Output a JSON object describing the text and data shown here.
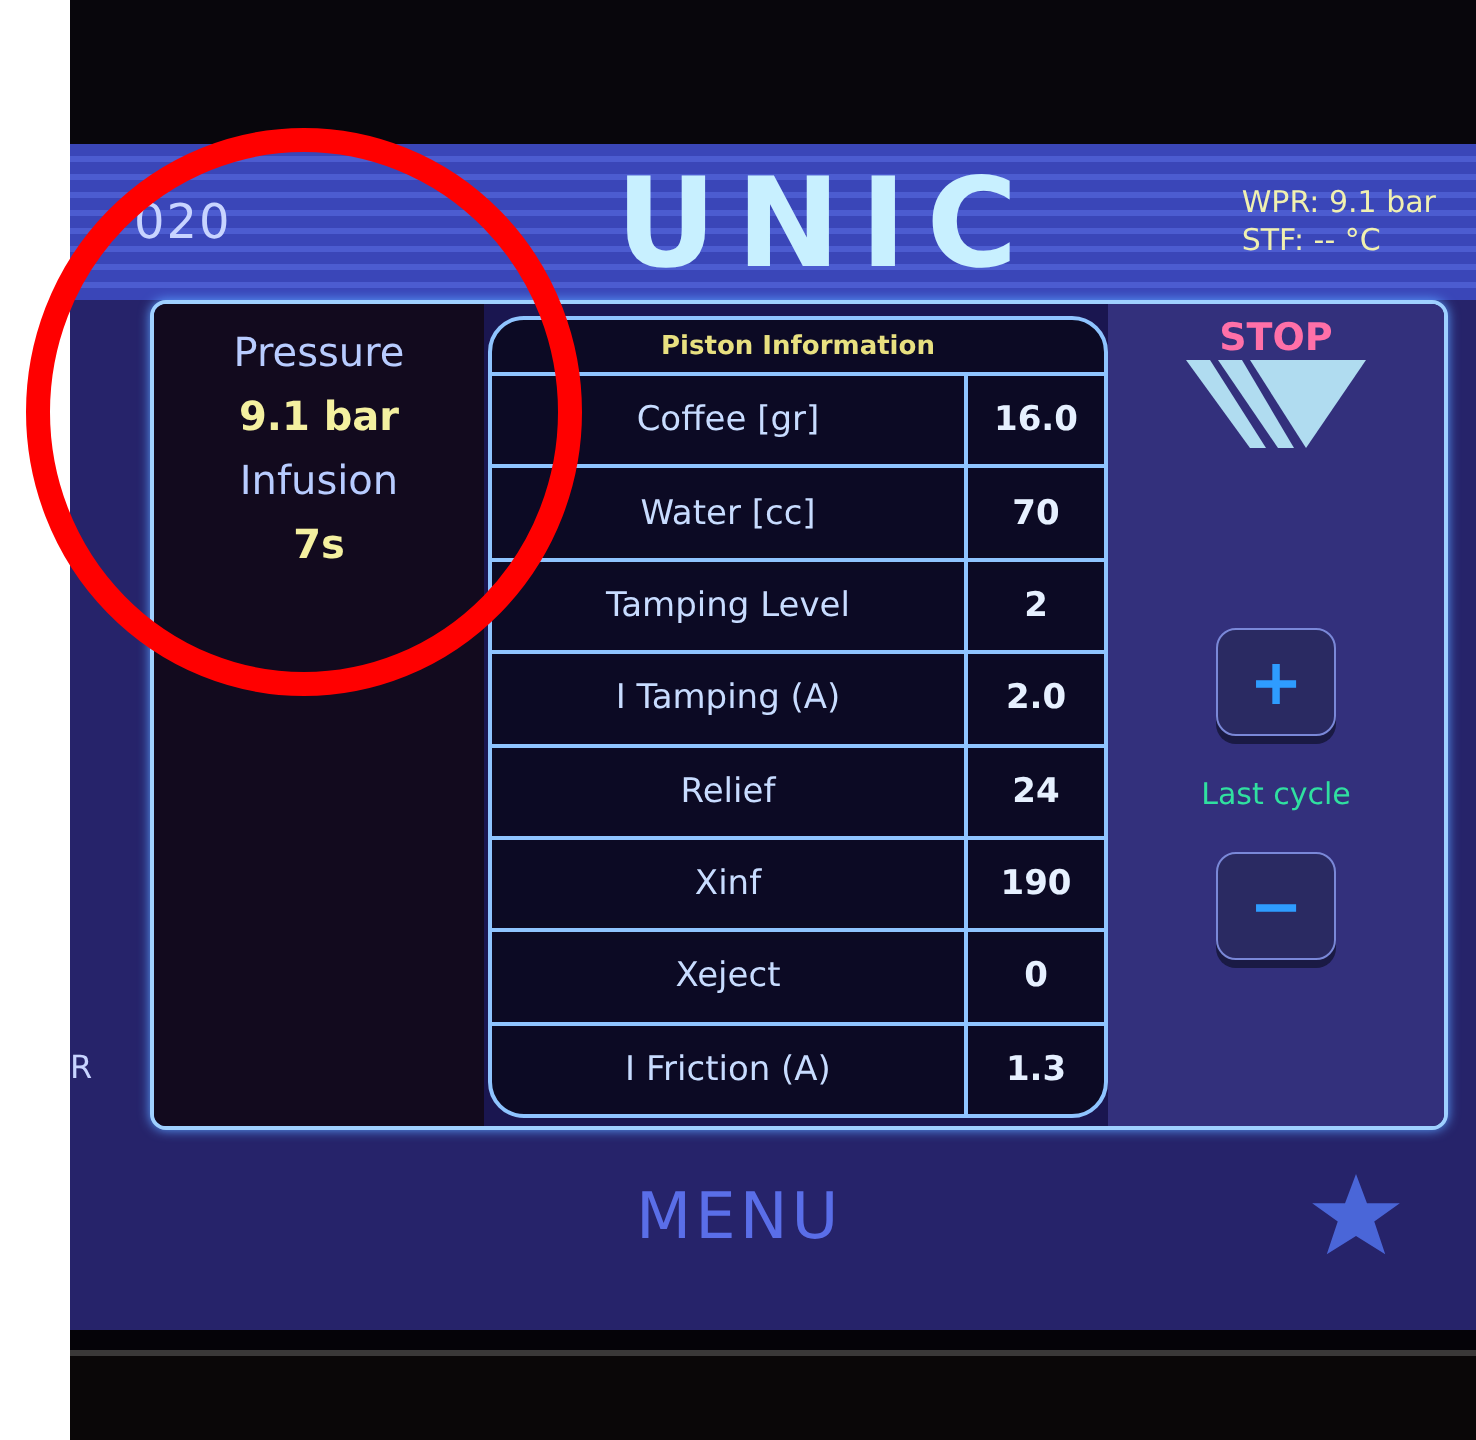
{
  "header": {
    "left_text": "020",
    "logo": "UNIC",
    "status": [
      "WPR: 9.1 bar",
      "STF: -- °C"
    ]
  },
  "side_text": "R",
  "info": {
    "items": [
      {
        "kind": "label",
        "text": "Pressure"
      },
      {
        "kind": "value",
        "text": "9.1 bar"
      },
      {
        "kind": "label",
        "text": "Infusion"
      },
      {
        "kind": "value",
        "text": "7s"
      }
    ]
  },
  "table": {
    "title": "Piston Information",
    "rows": [
      {
        "label": "Coffee [gr]",
        "value": "16.0"
      },
      {
        "label": "Water [cc]",
        "value": "70"
      },
      {
        "label": "Tamping Level",
        "value": "2"
      },
      {
        "label": "I Tamping (A)",
        "value": "2.0"
      },
      {
        "label": "Relief",
        "value": "24"
      },
      {
        "label": "Xinf",
        "value": "190"
      },
      {
        "label": "Xeject",
        "value": "0"
      },
      {
        "label": "I Friction (A)",
        "value": "1.3"
      }
    ]
  },
  "controls": {
    "stop": "STOP",
    "plus": "+",
    "cycle_label": "Last cycle",
    "minus": "−"
  },
  "footer": {
    "menu": "MENU"
  }
}
